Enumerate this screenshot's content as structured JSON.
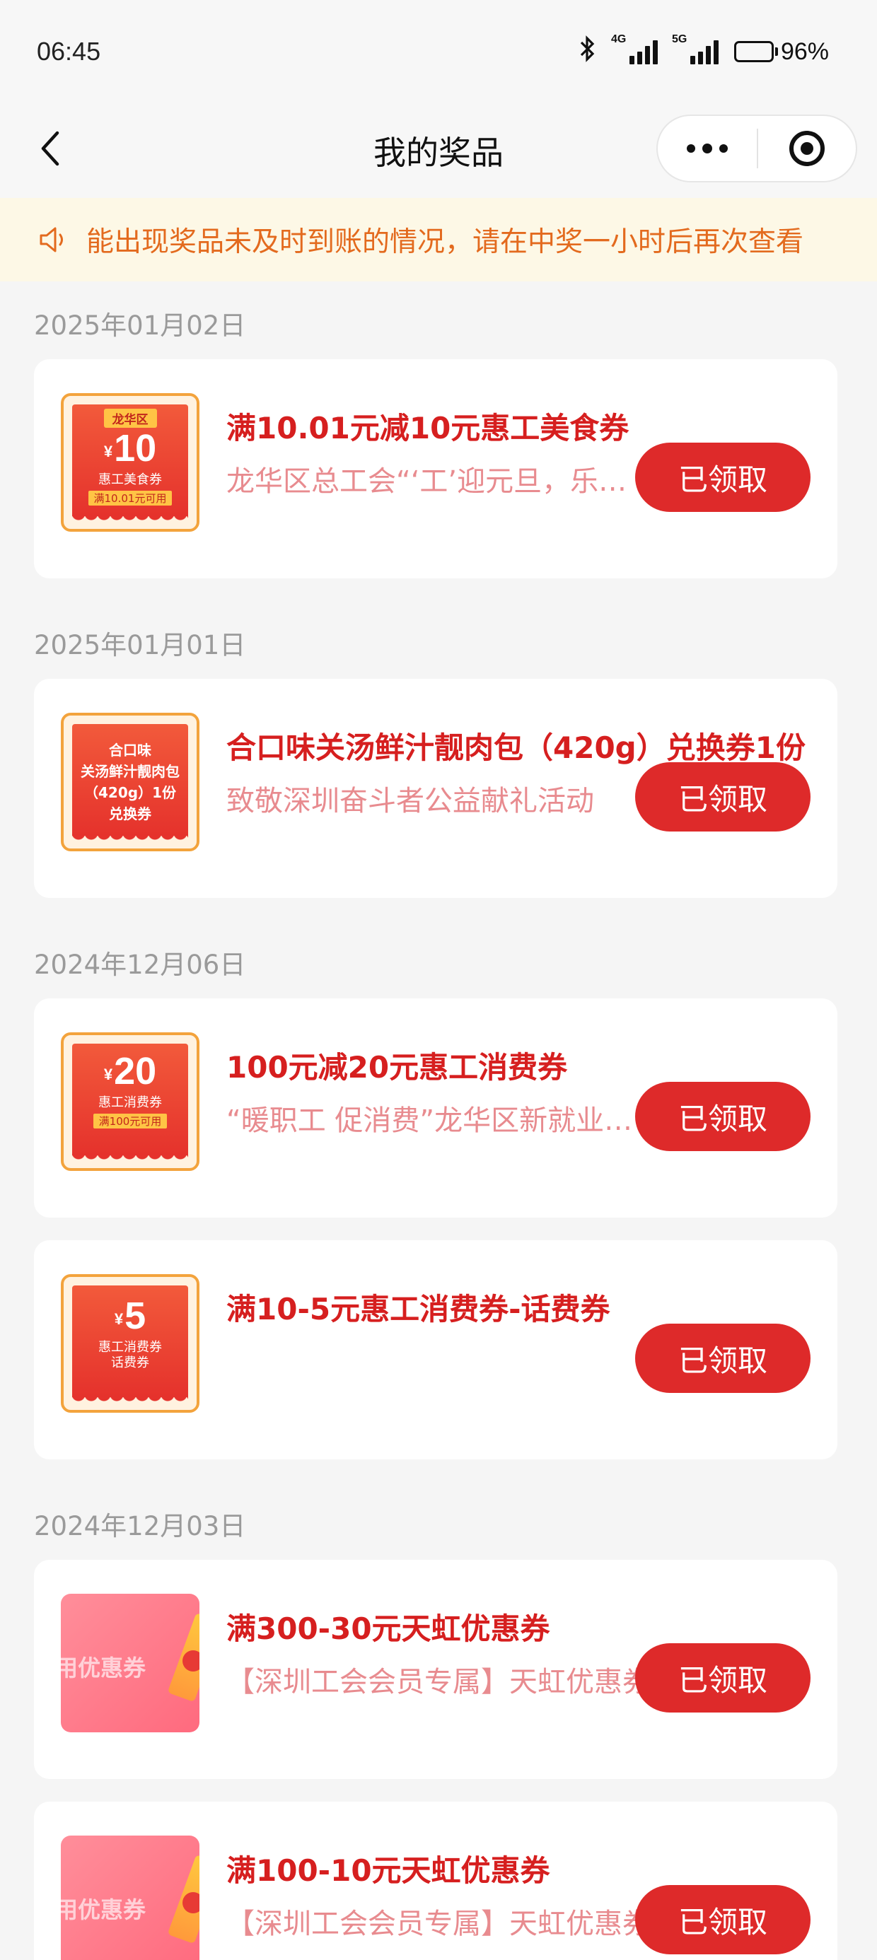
{
  "status_bar": {
    "time": "06:45",
    "network_1": "4G",
    "network_2": "5G",
    "battery": "96%"
  },
  "header": {
    "title": "我的奖品"
  },
  "notice": {
    "text": "能出现奖品未及时到账的情况，请在中奖一小时后再次查看"
  },
  "groups": [
    {
      "date": "2025年01月02日",
      "items": [
        {
          "title": "满10.01元减10元惠工美食券",
          "subtitle": "龙华区总工会“‘工’迎元旦，乐享美食”活动",
          "button": "已领取",
          "thumb": {
            "tag": "龙华区",
            "currency": "¥",
            "amount": "10",
            "name": "惠工美食券",
            "cond": "满10.01元可用"
          }
        }
      ]
    },
    {
      "date": "2025年01月01日",
      "items": [
        {
          "title": "合口味关汤鲜汁靓肉包（420g）兑换券1份",
          "subtitle": "致敬深圳奋斗者公益献礼活动",
          "button": "已领取",
          "thumb": {
            "line1": "合口味",
            "line2": "关汤鲜汁靓肉包",
            "line3": "（420g）1份",
            "line4": "兑换券"
          }
        }
      ]
    },
    {
      "date": "2024年12月06日",
      "items": [
        {
          "title": "100元减20元惠工消费券",
          "subtitle": "“暖职工 促消费”龙华区新就业形态劳动者",
          "button": "已领取",
          "thumb": {
            "currency": "¥",
            "amount": "20",
            "name": "惠工消费券",
            "cond": "满100元可用"
          }
        },
        {
          "title": "满10-5元惠工消费券-话费券",
          "subtitle": "",
          "button": "已领取",
          "thumb": {
            "currency": "¥",
            "amount": "5",
            "name": "惠工消费券",
            "name2": "话费券"
          }
        }
      ]
    },
    {
      "date": "2024年12月03日",
      "items": [
        {
          "title": "满300-30元天虹优惠券",
          "subtitle": "【深圳工会会员专属】天虹优惠券",
          "button": "已领取",
          "thumb": {
            "text": "用优惠券"
          }
        },
        {
          "title": "满100-10元天虹优惠券",
          "subtitle": "【深圳工会会员专属】天虹优惠券",
          "button": "已领取",
          "thumb": {
            "text": "用优惠券"
          }
        }
      ]
    }
  ],
  "colors": {
    "accent_red": "#de2a2a",
    "title_red": "#d61f1f",
    "subtitle_pink": "#e88b8f",
    "notice_orange": "#e36a1e",
    "notice_bg": "#fdf8e6"
  }
}
